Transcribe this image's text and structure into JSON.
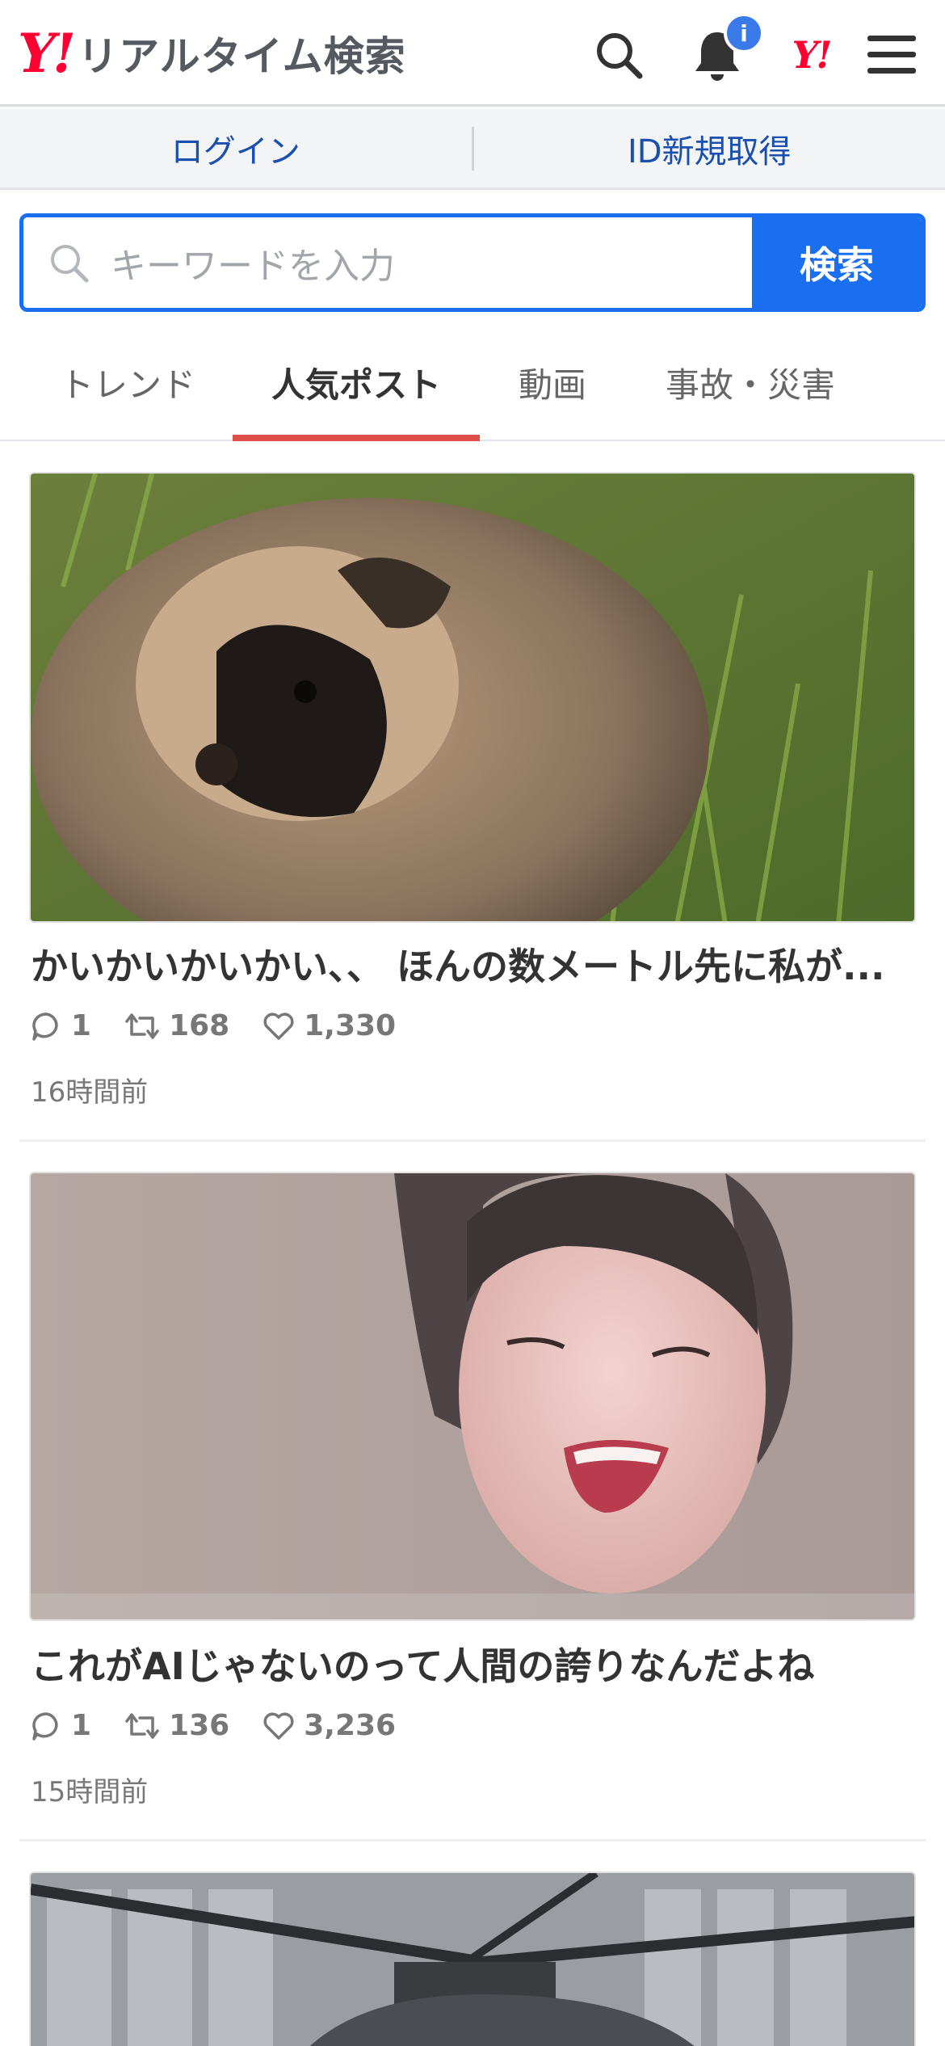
{
  "header": {
    "logo_mark": "Y!",
    "logo_text": "リアルタイム検索",
    "notification_badge": "i",
    "yj_mark": "Y!"
  },
  "account": {
    "login": "ログイン",
    "signup": "ID新規取得"
  },
  "search": {
    "placeholder": "キーワードを入力",
    "button": "検索"
  },
  "tabs": [
    {
      "label": "トレンド",
      "active": false
    },
    {
      "label": "人気ポスト",
      "active": true
    },
    {
      "label": "動画",
      "active": false
    },
    {
      "label": "事故・災害",
      "active": false
    }
  ],
  "posts": [
    {
      "title": "かいかいかいかい、、 ほんの数メートル先に私が...",
      "replies": "1",
      "reposts": "168",
      "likes": "1,330",
      "time": "16時間前",
      "image": "raccoon-dog-photo"
    },
    {
      "title": "これがAIじゃないのって人間の誇りなんだよね",
      "replies": "1",
      "reposts": "136",
      "likes": "3,236",
      "time": "15時間前",
      "image": "singer-photo"
    },
    {
      "image": "helicopter-photo"
    }
  ],
  "colors": {
    "brand_red": "#ff0033",
    "accent_blue": "#1a6ff0",
    "tab_indicator": "#e0504a",
    "link_blue": "#1a4fb0"
  }
}
